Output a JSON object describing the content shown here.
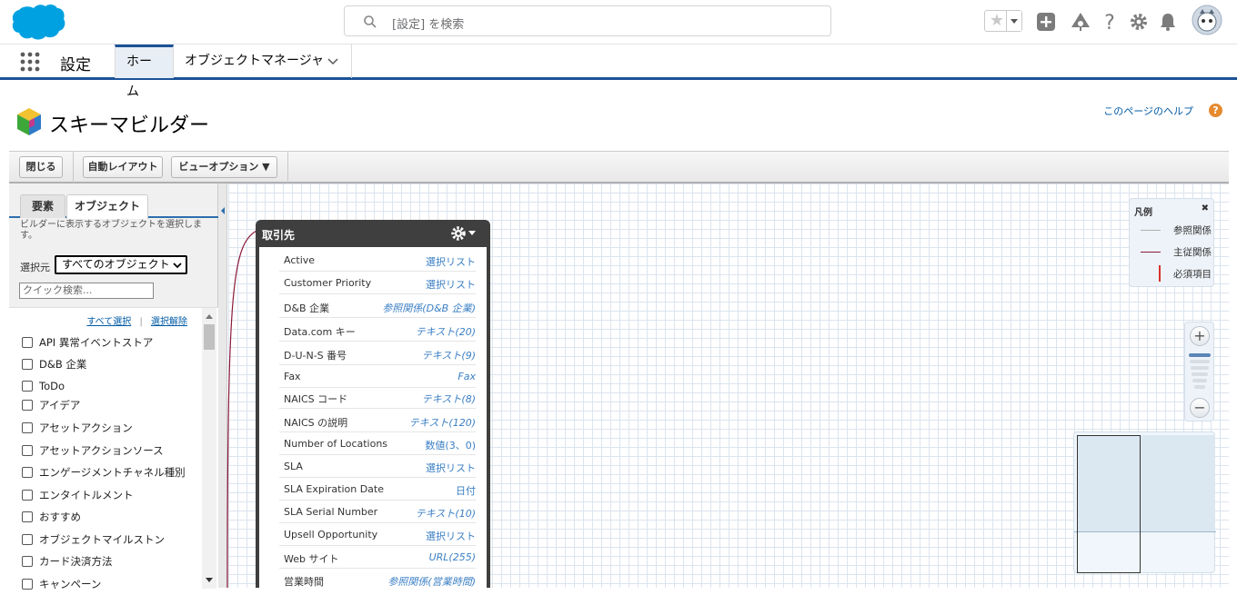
{
  "header": {
    "search_placeholder": "[設定] を検索"
  },
  "nav": {
    "app_name": "設定",
    "tabs": [
      {
        "label": "ホーム"
      },
      {
        "label": "オブジェクトマネージャ"
      }
    ]
  },
  "page": {
    "title": "スキーマビルダー",
    "help_link": "このページのヘルプ"
  },
  "toolbar": {
    "close_label": "閉じる",
    "auto_layout_label": "自動レイアウト",
    "view_options_label": "ビューオプション ▼"
  },
  "left_panel": {
    "tabs": [
      "要素",
      "オブジェクト"
    ],
    "description": "ビルダーに表示するオブジェクトを選択します。",
    "source_label": "選択元",
    "source_value": "すべてのオブジェクト",
    "quick_search_placeholder": "クイック検索...",
    "select_all": "すべて選択",
    "separator": "|",
    "deselect": "選択解除",
    "objects": [
      "API 異常イベントストア",
      "D&B 企業",
      "ToDo",
      "アイデア",
      "アセットアクション",
      "アセットアクションソース",
      "エンゲージメントチャネル種別",
      "エンタイトルメント",
      "おすすめ",
      "オブジェクトマイルストン",
      "カード決済方法",
      "キャンペーン"
    ]
  },
  "card": {
    "title": "取引先",
    "fields": [
      {
        "name": "Active",
        "type": "選択リスト"
      },
      {
        "name": "Customer Priority",
        "type": "選択リスト"
      },
      {
        "name": "D&B 企業",
        "type": "参照関係(D&B 企業)"
      },
      {
        "name": "Data.com キー",
        "type": "テキスト(20)"
      },
      {
        "name": "D-U-N-S 番号",
        "type": "テキスト(9)"
      },
      {
        "name": "Fax",
        "type": "Fax"
      },
      {
        "name": "NAICS コード",
        "type": "テキスト(8)"
      },
      {
        "name": "NAICS の説明",
        "type": "テキスト(120)"
      },
      {
        "name": "Number of Locations",
        "type": "数値(3、0)"
      },
      {
        "name": "SLA",
        "type": "選択リスト"
      },
      {
        "name": "SLA Expiration Date",
        "type": "日付"
      },
      {
        "name": "SLA Serial Number",
        "type": "テキスト(10)"
      },
      {
        "name": "Upsell Opportunity",
        "type": "選択リスト"
      },
      {
        "name": "Web サイト",
        "type": "URL(255)"
      },
      {
        "name": "営業時間",
        "type": "参照関係(営業時間)"
      }
    ]
  },
  "legend": {
    "title": "凡例",
    "close": "✖",
    "items": [
      {
        "label": "参照関係",
        "color": "#b0b0b0"
      },
      {
        "label": "主従関係",
        "color": "#8b1a3a"
      },
      {
        "label": "必須項目",
        "color": "#d9312c"
      }
    ]
  },
  "zoom": {
    "in": "+",
    "out": "−"
  },
  "colors": {
    "brand": "#00a1e0",
    "nav_accent": "#1b5297",
    "link": "#015ba7",
    "field_type": "#3b7fc4",
    "card_header": "#3f3f3f"
  }
}
